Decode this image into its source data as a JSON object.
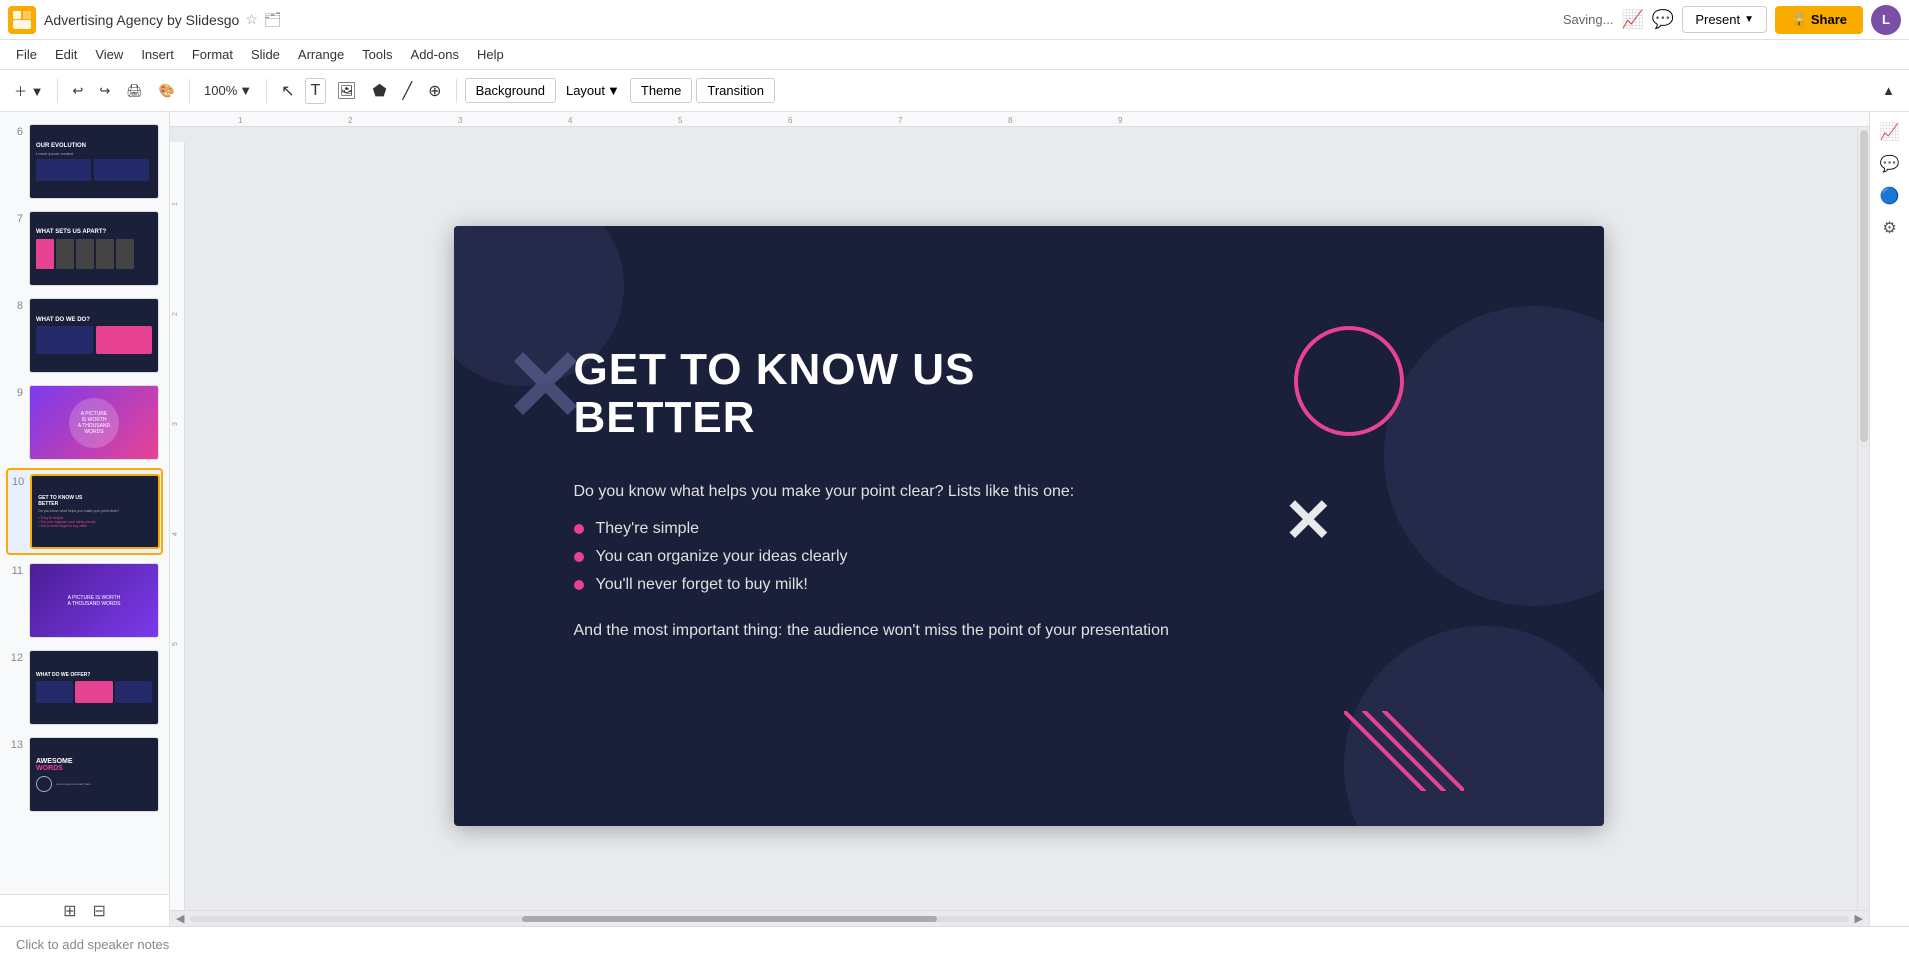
{
  "app": {
    "logo_color": "#f9ab00",
    "title": "Advertising Agency by Slidesgo",
    "saving_text": "Saving...",
    "star_icon": "☆",
    "folder_icon": "📁"
  },
  "menu": {
    "items": [
      "File",
      "Edit",
      "View",
      "Insert",
      "Format",
      "Slide",
      "Arrange",
      "Tools",
      "Add-ons",
      "Help"
    ]
  },
  "toolbar": {
    "zoom_level": "100",
    "background_label": "Background",
    "layout_label": "Layout",
    "theme_label": "Theme",
    "transition_label": "Transition",
    "collapse_icon": "▲"
  },
  "header": {
    "present_label": "Present",
    "share_label": "Share",
    "avatar_text": "L"
  },
  "slides": [
    {
      "number": "6",
      "mini_title": "OUR EVOLUTION",
      "type": "sp-6"
    },
    {
      "number": "7",
      "mini_title": "WHAT SETS US APART?",
      "type": "sp-7"
    },
    {
      "number": "8",
      "mini_title": "WHAT DO WE DO?",
      "type": "sp-8"
    },
    {
      "number": "9",
      "mini_title": "A PICTURE IS WORTH...",
      "type": "sp-9"
    },
    {
      "number": "10",
      "mini_title": "GET TO KNOW US BETTER",
      "type": "sp-10",
      "active": true
    },
    {
      "number": "11",
      "mini_title": "A PICTURE IS WORTH...",
      "type": "sp-11"
    },
    {
      "number": "12",
      "mini_title": "WHAT DO WE OFFER?",
      "type": "sp-12"
    },
    {
      "number": "13",
      "mini_title": "AWESOME WORDS",
      "type": "sp-13"
    }
  ],
  "slide": {
    "title_line1": "GET TO KNOW US",
    "title_line2": "BETTER",
    "body_text": "Do you know what helps you make your point clear? Lists like this one:",
    "list_items": [
      "They're simple",
      "You can organize your ideas clearly",
      "You'll never forget to buy milk!"
    ],
    "footer_text": "And the most important thing: the audience won't miss the point of your presentation"
  },
  "notes": {
    "placeholder": "Click to add speaker notes"
  },
  "right_panel": {
    "icons": [
      "trending-up",
      "chat",
      "present",
      "circle-blue",
      "settings"
    ]
  }
}
